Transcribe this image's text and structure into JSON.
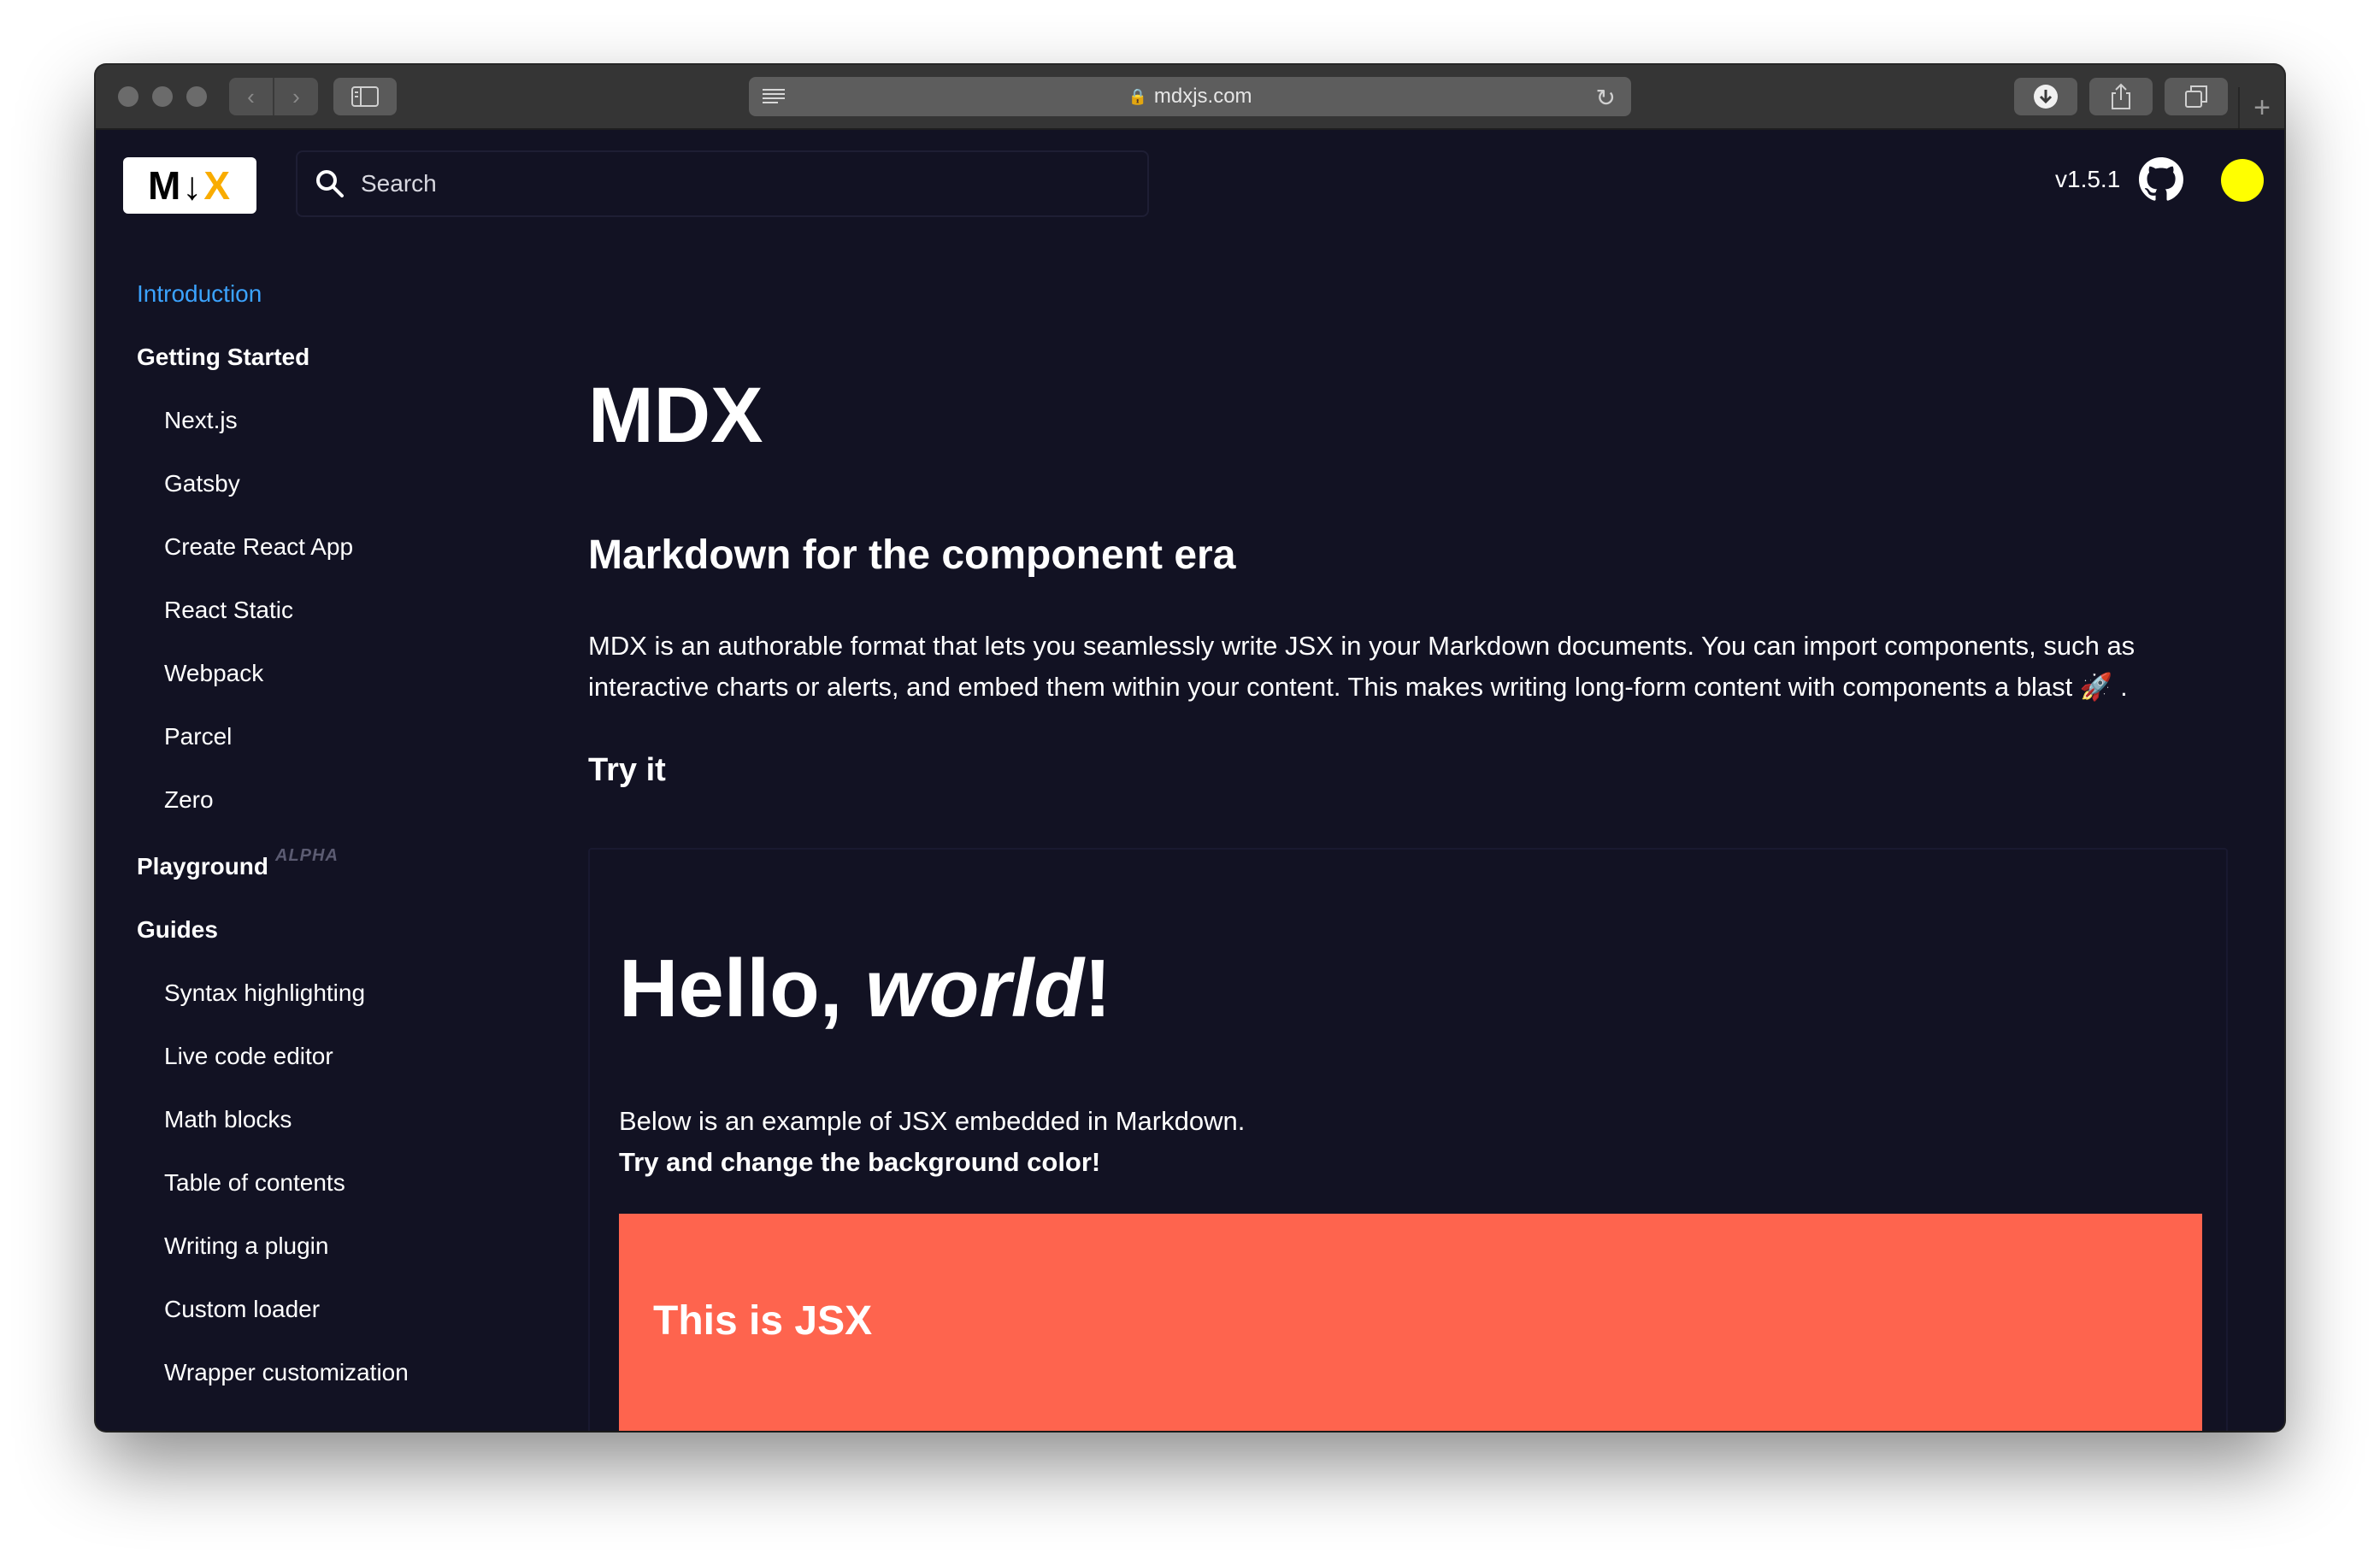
{
  "browser": {
    "url": "mdxjs.com",
    "lock_icon": "lock-icon",
    "traffic_light_color": "#6b6b6b"
  },
  "header": {
    "logo": {
      "left": "M↓",
      "right": "X",
      "accent": "#f9ac00"
    },
    "search": {
      "placeholder": "Search"
    },
    "version": "v1.5.1",
    "theme_toggle_color": "#ffff00"
  },
  "sidebar": {
    "items": [
      {
        "label": "Introduction",
        "type": "active"
      },
      {
        "label": "Getting Started",
        "type": "section"
      },
      {
        "label": "Next.js",
        "type": "sub"
      },
      {
        "label": "Gatsby",
        "type": "sub"
      },
      {
        "label": "Create React App",
        "type": "sub"
      },
      {
        "label": "React Static",
        "type": "sub"
      },
      {
        "label": "Webpack",
        "type": "sub"
      },
      {
        "label": "Parcel",
        "type": "sub"
      },
      {
        "label": "Zero",
        "type": "sub"
      },
      {
        "label": "Playground",
        "type": "section",
        "badge": "ALPHA"
      },
      {
        "label": "Guides",
        "type": "section"
      },
      {
        "label": "Syntax highlighting",
        "type": "sub"
      },
      {
        "label": "Live code editor",
        "type": "sub"
      },
      {
        "label": "Math blocks",
        "type": "sub"
      },
      {
        "label": "Table of contents",
        "type": "sub"
      },
      {
        "label": "Writing a plugin",
        "type": "sub"
      },
      {
        "label": "Custom loader",
        "type": "sub"
      },
      {
        "label": "Wrapper customization",
        "type": "sub"
      }
    ],
    "active_color": "#3ba3ff"
  },
  "main": {
    "title": "MDX",
    "subtitle": "Markdown for the component era",
    "intro_line1": "MDX is an authorable format that lets you seamlessly write JSX in your Markdown documents. You can import components, such as",
    "intro_line2": "interactive charts or alerts, and embed them within your content. This makes writing long-form content with components a blast 🚀 .",
    "try_heading": "Try it",
    "demo": {
      "heading_plain": "Hello, ",
      "heading_italic": "world",
      "heading_end": "!",
      "line1": "Below is an example of JSX embedded in Markdown.",
      "line2": "Try and change the background color!",
      "jsx_text": "This is JSX",
      "jsx_bg": "#fe644e"
    }
  }
}
